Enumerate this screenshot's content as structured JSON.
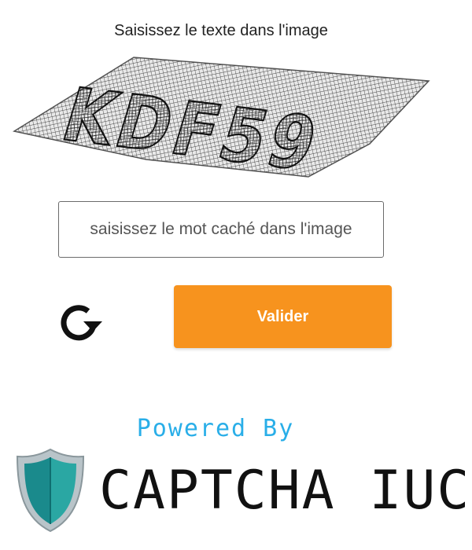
{
  "captcha": {
    "prompt": "Saisissez le texte dans l'image",
    "image_text": "KDF59",
    "input_placeholder": "saisissez le mot caché dans l'image",
    "input_value": "",
    "refresh_icon": "refresh-icon",
    "validate_label": "Valider"
  },
  "branding": {
    "powered_by": "Powered By",
    "name": "CAPTCHA IUC",
    "logo_icon": "shield-icon"
  },
  "colors": {
    "button_orange": "#f7931e",
    "powered_by_blue": "#29aee8",
    "shield_teal": "#1a8a8c",
    "text_dark": "#222222"
  }
}
